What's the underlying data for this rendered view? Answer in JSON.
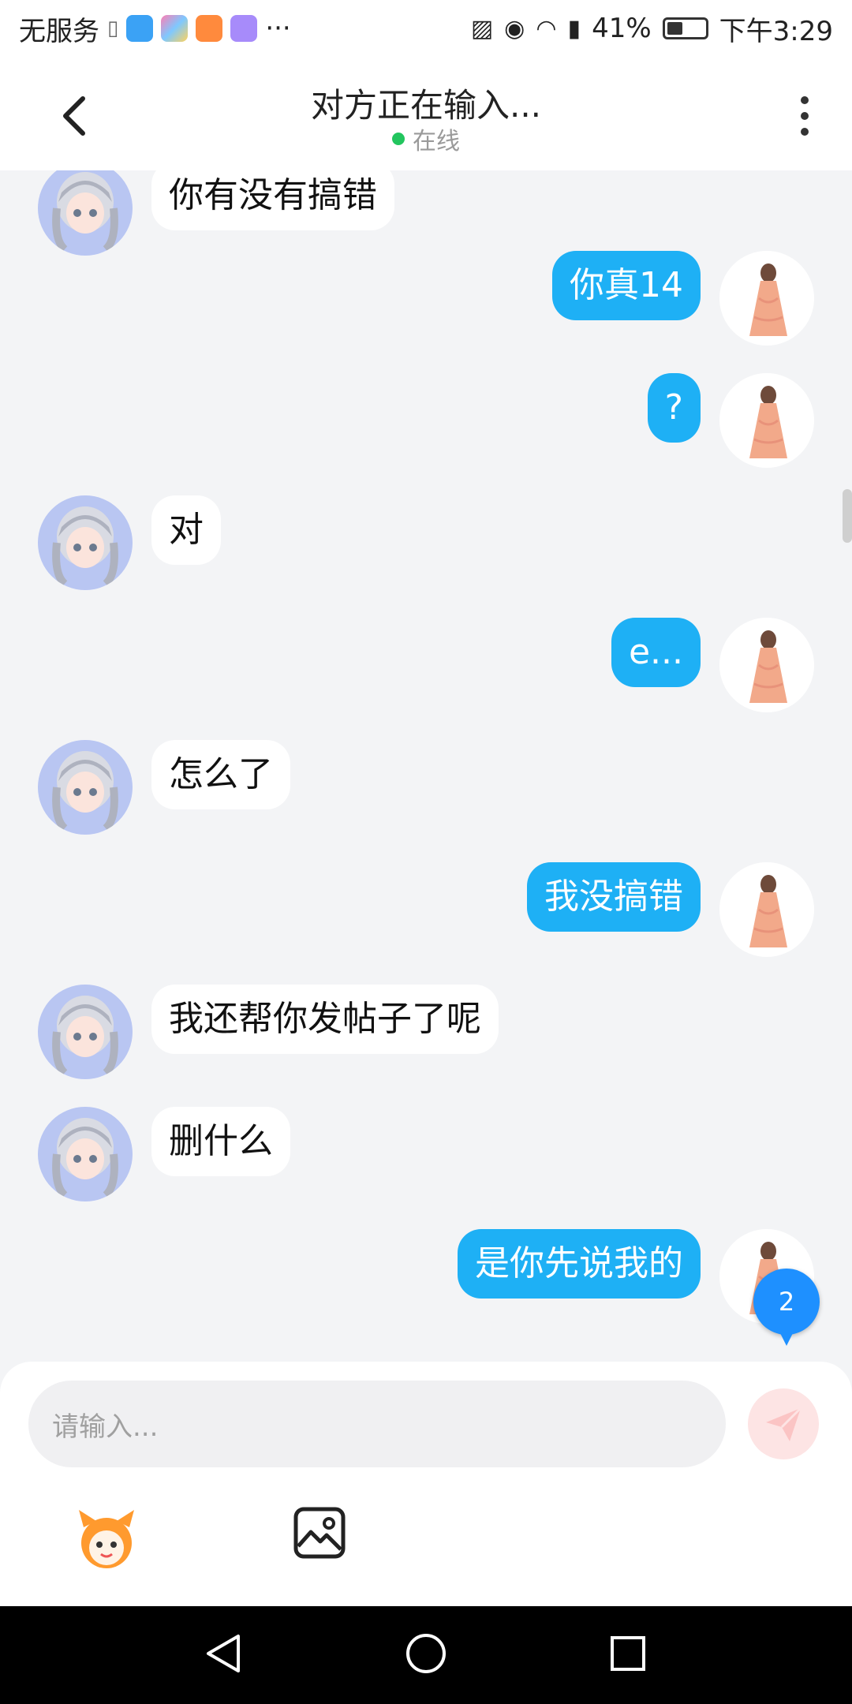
{
  "status_bar": {
    "carrier": "无服务",
    "battery": "41%",
    "time": "下午3:29",
    "more": "···",
    "battery_level": 0.41
  },
  "header": {
    "title": "对方正在输入...",
    "status": "在线",
    "status_color": "#22c55e"
  },
  "messages": [
    {
      "side": "left",
      "text": "你有没有搞错"
    },
    {
      "side": "right",
      "text": "你真14"
    },
    {
      "side": "right",
      "text": "?"
    },
    {
      "side": "left",
      "text": "对"
    },
    {
      "side": "right",
      "text": "e..."
    },
    {
      "side": "left",
      "text": "怎么了"
    },
    {
      "side": "right",
      "text": "我没搞错"
    },
    {
      "side": "left",
      "text": "我还帮你发帖子了呢"
    },
    {
      "side": "left",
      "text": "删什么"
    },
    {
      "side": "right",
      "text": "是你先说我的"
    }
  ],
  "unread_badge": "2",
  "input": {
    "placeholder": "请输入..."
  },
  "colors": {
    "accent": "#1eb0f5",
    "background": "#f3f4f6"
  }
}
